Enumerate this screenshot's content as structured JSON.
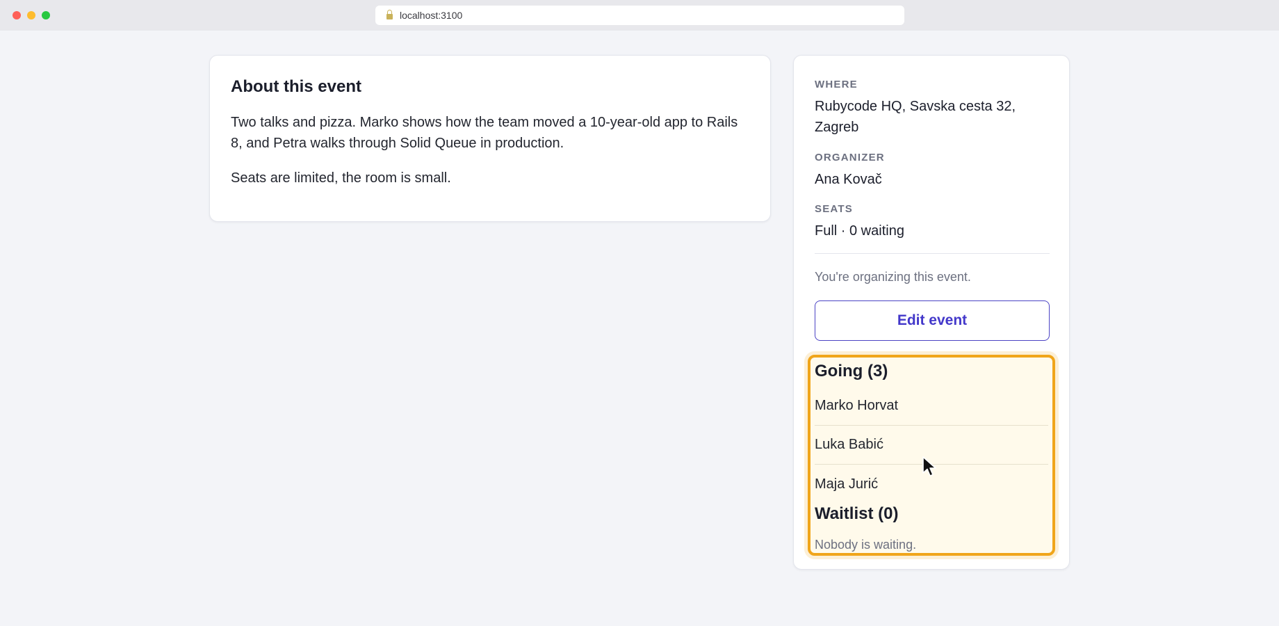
{
  "browser": {
    "url": "localhost:3100"
  },
  "about": {
    "title": "About this event",
    "paragraphs": [
      "Two talks and pizza. Marko shows how the team moved a 10-year-old app to Rails 8, and Petra walks through Solid Queue in production.",
      "Seats are limited, the room is small."
    ]
  },
  "sidebar": {
    "where_label": "WHERE",
    "where_value": "Rubycode HQ, Savska cesta 32, Zagreb",
    "organizer_label": "ORGANIZER",
    "organizer_value": "Ana Kovač",
    "seats_label": "SEATS",
    "seats_value": "Full · 0 waiting",
    "organizer_note": "You're organizing this event.",
    "edit_button": "Edit event"
  },
  "attendees": {
    "going_heading": "Going (3)",
    "going": [
      "Marko Horvat",
      "Luka Babić",
      "Maja Jurić"
    ],
    "waitlist_heading": "Waitlist (0)",
    "waitlist_empty": "Nobody is waiting."
  },
  "colors": {
    "accent": "#4338ca",
    "highlight_border": "#f0a51a",
    "highlight_bg": "#fffaeb"
  }
}
